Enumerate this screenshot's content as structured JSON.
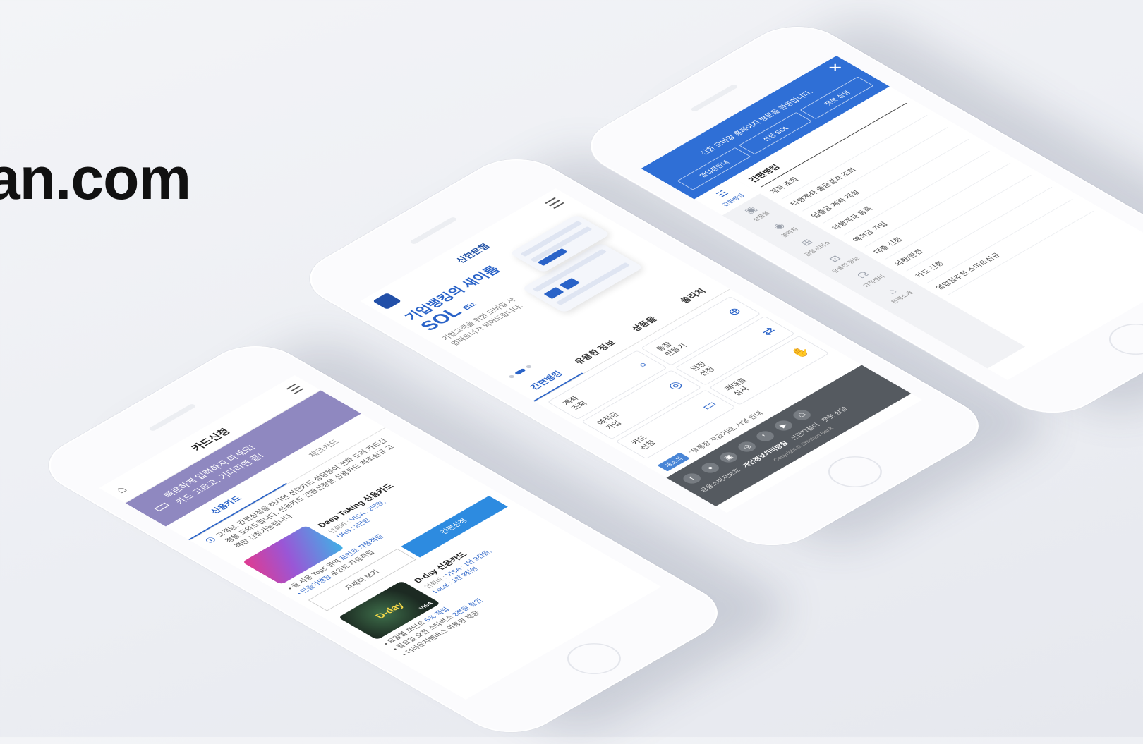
{
  "hero": {
    "domain_text": "an.com"
  },
  "left_phone": {
    "header": {
      "title": "카드신청",
      "home_icon": "home-icon",
      "menu_icon": "hamburger-icon"
    },
    "banner": {
      "line1": "빠르하게 입력하지 마세요!",
      "line2": "카드 고르고, 기다리면 끝!",
      "color": "#8f88c0"
    },
    "tabs": [
      {
        "label": "신용카드",
        "active": true
      },
      {
        "label": "체크카드",
        "active": false
      }
    ],
    "notice": "고객님, 간편신청을 하시면 신한카드 상담원이 전화 드려 카드신청을 도와드립니다. 신용카드 간편신청은 신용카드 최초신규 고객만 신청가능합니다.",
    "cards": [
      {
        "name": "Deep Taking 신용카드",
        "brand_prefix": "연회비 :",
        "brand_visa": "VISA : 2만원,",
        "brand_urs": "URS : 2만원",
        "benefit1_pre": "• 월 사용 Top5 영역",
        "benefit1_hl": "포인트 자동적립",
        "benefit2_hl": "• 단골가맹점",
        "benefit2_post": "포인트 자동적립",
        "detail_label": "자세히 보기",
        "apply_label": "간편신청"
      },
      {
        "name": "D-day 신용카드",
        "brand_prefix": "연회비 :",
        "brand_visa": "VISA : 1만 8천원,",
        "brand_local": "Local : 1만 8천원",
        "image_text": "D-day",
        "visa_mark": "VISA",
        "benefit1_pre": "• 요일별 포인트",
        "benefit1_hl": "5% 적립",
        "benefit2_pre": "• 월요일 오전 스타벅스",
        "benefit2_hl": "2천원 할인",
        "benefit3": "• 더라운지멤버스 이용권 제공"
      }
    ]
  },
  "middle_phone": {
    "logo": "신한은행",
    "hero_title": "기업뱅킹의 새이름",
    "hero_brand": "SOL",
    "hero_brand_suffix": "Biz",
    "hero_desc": "기업고객을 위한 모바일 사업파트너가 되어드립니다.",
    "tabs": [
      {
        "label": "간편뱅킹",
        "active": true
      },
      {
        "label": "유용한 정보",
        "active": false
      },
      {
        "label": "상품몰",
        "active": false
      },
      {
        "label": "쏠리치",
        "active": false
      }
    ],
    "quick_menu": [
      {
        "label": "계좌\n조회",
        "icon": "search-document-icon"
      },
      {
        "label": "통장\n만들기",
        "icon": "add-document-icon"
      },
      {
        "label": "예적금\n가입",
        "icon": "coins-icon"
      },
      {
        "label": "완전\n신청",
        "icon": "exchange-icon"
      },
      {
        "label": "카드\n신청",
        "icon": "card-icon"
      },
      {
        "label": "쾌대출\n심사",
        "icon": "hand-money-icon"
      }
    ],
    "news": {
      "badge": "새소식",
      "text": "\"유통장 지급거래, 서명 안내"
    },
    "footer": {
      "social": [
        "f",
        "●",
        "▣",
        "◎",
        "❜",
        "▶",
        "☖"
      ],
      "links": [
        "금융소비자보호",
        "개인정보처리방침",
        "신한지점이",
        "챗봇 상담"
      ],
      "copyright": "Copyright © Shinhan Bank"
    }
  },
  "right_phone": {
    "welcome": "신한 모바일 홈페이지 방문을 환영합니다.",
    "buttons": [
      "영업점안내",
      "신한 SOL",
      "챗봇 상담"
    ],
    "side_menu": [
      {
        "label": "간편뱅킹",
        "icon": "banking-icon",
        "active": true
      },
      {
        "label": "상품몰",
        "icon": "shop-icon",
        "active": false
      },
      {
        "label": "쏠리치",
        "icon": "coin-icon",
        "active": false
      },
      {
        "label": "금융서비스",
        "icon": "service-icon",
        "active": false
      },
      {
        "label": "유용한 정보",
        "icon": "info-icon",
        "active": false
      },
      {
        "label": "고객센터",
        "icon": "headset-icon",
        "active": false
      },
      {
        "label": "은행소개",
        "icon": "bank-icon",
        "active": false
      }
    ],
    "category": "간편뱅킹",
    "items": [
      "계좌 조회",
      "타행계좌 출금결과 조회",
      "입출금 계좌 개설",
      "타행계좌 등록",
      "예적금 가입",
      "대출 신청",
      "외환/환전",
      "카드 신청",
      "영업점추천 스마트신규"
    ]
  }
}
